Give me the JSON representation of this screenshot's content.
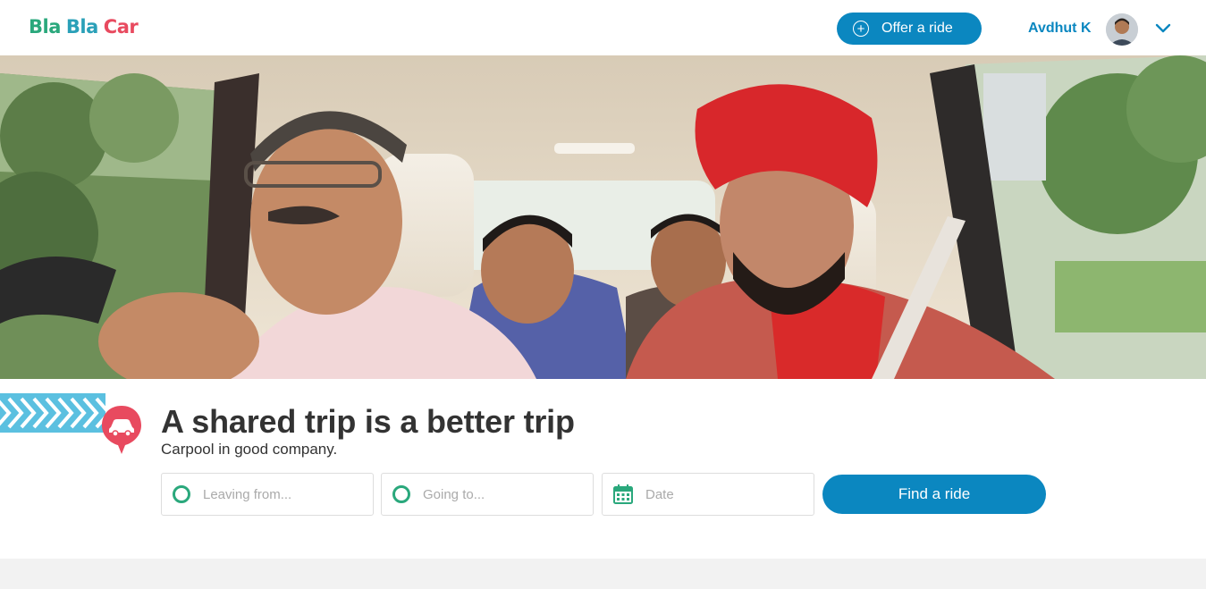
{
  "header": {
    "logo": {
      "part1": "Bla",
      "part2": "Bla",
      "part3": "Car"
    },
    "offer_ride_label": "Offer a ride",
    "user_name": "Avdhut K"
  },
  "hero": {
    "headline": "A shared trip is a better trip",
    "subline": "Carpool in good company."
  },
  "search": {
    "leaving_placeholder": "Leaving from...",
    "going_placeholder": "Going to...",
    "date_placeholder": "Date",
    "find_label": "Find a ride"
  },
  "colors": {
    "brand_blue": "#0b87c0",
    "brand_green": "#2aa87c",
    "brand_teal": "#2aa0b8",
    "brand_red": "#e84a5f",
    "stripe_blue": "#5bc0e0"
  },
  "icons": [
    "plus-circle-icon",
    "chevron-down-icon",
    "location-ring-icon",
    "calendar-icon",
    "car-pin-icon"
  ]
}
